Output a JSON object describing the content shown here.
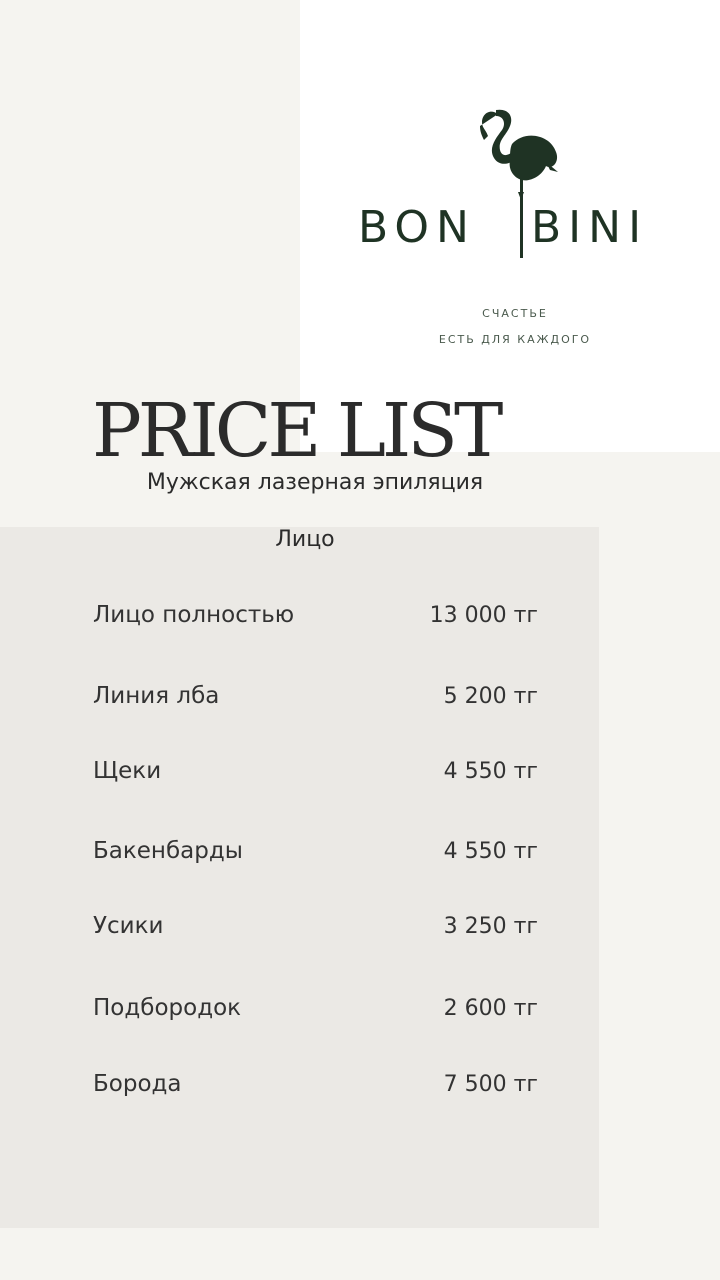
{
  "brand": {
    "name_left": "BON",
    "name_right": "BINI",
    "tagline_line1": "СЧАСТЬЕ",
    "tagline_line2": "ЕСТЬ ДЛЯ КАЖДОГО",
    "color": "#1f3324"
  },
  "title": "PRICE LIST",
  "subtitle": "Мужская лазерная эпиляция",
  "section": "Лицо",
  "items": [
    {
      "name": "Лицо полностью",
      "price": "13 000 тг"
    },
    {
      "name": "Линия лба",
      "price": "5 200 тг"
    },
    {
      "name": "Щеки",
      "price": "4 550 тг"
    },
    {
      "name": "Бакенбарды",
      "price": "4 550 тг"
    },
    {
      "name": "Усики",
      "price": "3 250 тг"
    },
    {
      "name": "Подбородок",
      "price": "2 600 тг"
    },
    {
      "name": "Борода",
      "price": "7 500 тг"
    }
  ]
}
